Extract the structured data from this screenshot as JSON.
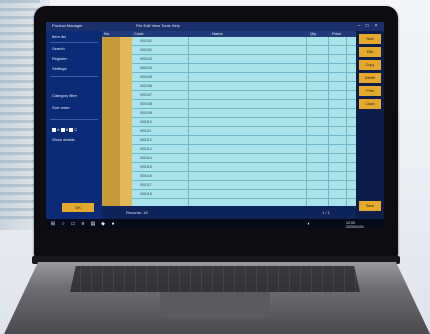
{
  "app": {
    "title": "Product Manager",
    "menu": "File  Edit  View  Tools  Help"
  },
  "sidebar": {
    "rows": [
      {
        "label": "Item list"
      },
      {
        "label": "Search"
      },
      {
        "label": "Register"
      },
      {
        "label": "Settings"
      }
    ],
    "section2": [
      {
        "label": "Category filter"
      },
      {
        "label": "Sort order"
      }
    ],
    "checks": [
      "A",
      "B",
      "C"
    ],
    "footer_label": "Show details"
  },
  "table": {
    "headers": [
      "No.",
      "Code",
      "Name",
      "Qty",
      "Price"
    ],
    "rows": [
      {
        "code": "000101"
      },
      {
        "code": "000102"
      },
      {
        "code": "000103"
      },
      {
        "code": "000104"
      },
      {
        "code": "000105"
      },
      {
        "code": "000106"
      },
      {
        "code": "000107"
      },
      {
        "code": "000108"
      },
      {
        "code": "000109"
      },
      {
        "code": "000110"
      },
      {
        "code": "000111"
      },
      {
        "code": "000112"
      },
      {
        "code": "000113"
      },
      {
        "code": "000114"
      },
      {
        "code": "000115"
      },
      {
        "code": "000116"
      },
      {
        "code": "000117"
      },
      {
        "code": "000118"
      }
    ]
  },
  "bottom": {
    "status": "Records: 18",
    "page": "1 / 1"
  },
  "buttons": {
    "ok": "OK",
    "right": [
      "New",
      "Edit",
      "Copy",
      "Delete",
      "Print",
      "Close"
    ],
    "right_bottom": "Save"
  },
  "taskbar": {
    "time": "12:00",
    "date": "2020/01/01"
  },
  "colors": {
    "accent": "#e3a92d",
    "grid": "#a8e4ea",
    "sidebar": "#0b2b76"
  }
}
